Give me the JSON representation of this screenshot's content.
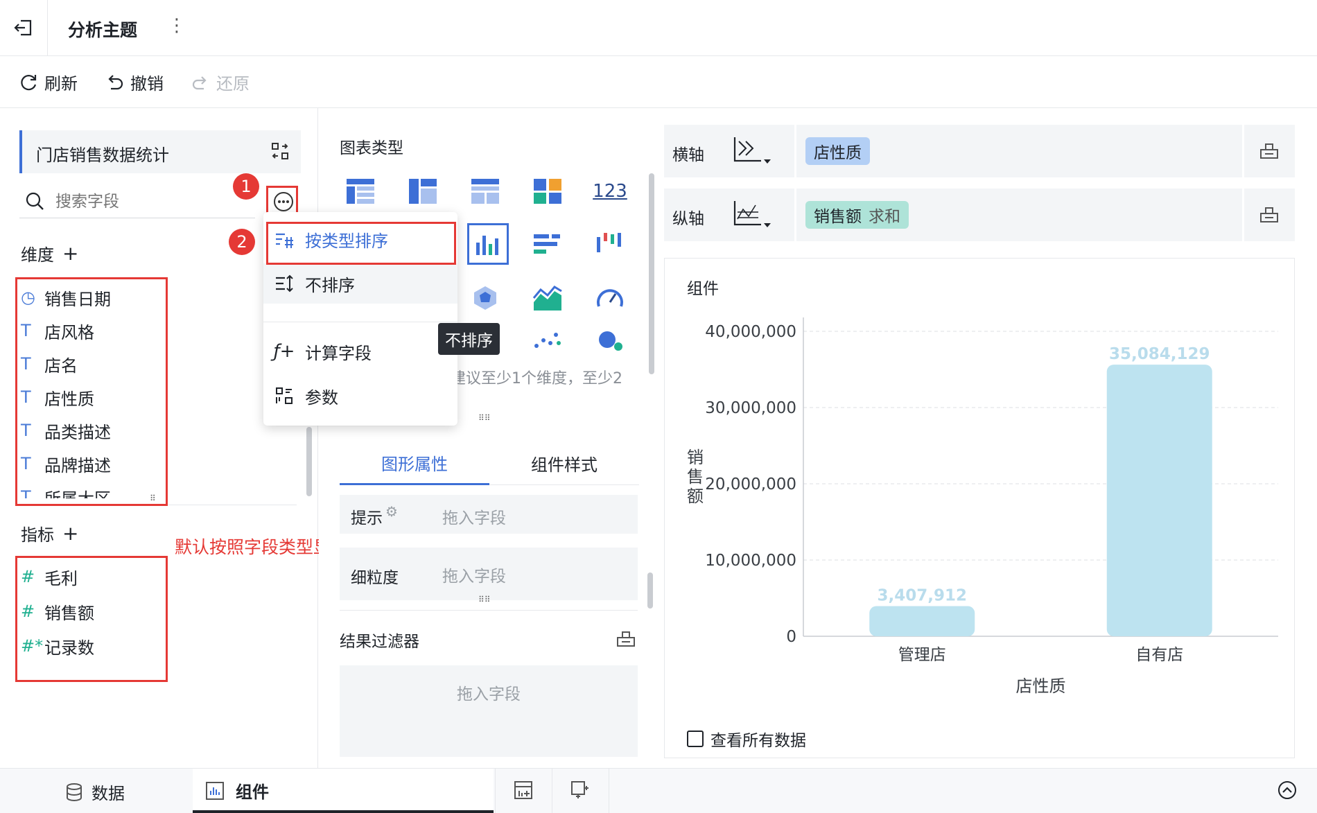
{
  "topbar": {
    "title": "分析主题",
    "more": "⋮"
  },
  "toolbar": {
    "refresh": "刷新",
    "undo": "撤销",
    "redo": "还原"
  },
  "left": {
    "dataset": "门店销售数据统计",
    "search_placeholder": "搜索字段",
    "dim_title": "维度",
    "dimensions": [
      "销售日期",
      "店风格",
      "店名",
      "店性质",
      "品类描述",
      "品牌描述",
      "所属大区"
    ],
    "measure_title": "指标",
    "measures": [
      "毛利",
      "销售额",
      "记录数"
    ],
    "annotation": "默认按照字段类型显示字段顺序"
  },
  "menu": {
    "items": [
      "按类型排序",
      "不排序",
      "计算字段",
      "参数"
    ],
    "badge1": "1",
    "badge2": "2",
    "tooltip": "不排序"
  },
  "mid": {
    "chart_type_title": "图表类型",
    "chart_123": "123",
    "hint": "建议至少1个维度，至少2",
    "tab_graph": "图形属性",
    "tab_style": "组件样式",
    "tip_label": "提示",
    "drag_here": "拖入字段",
    "granularity_label": "细粒度",
    "filter_title": "结果过滤器"
  },
  "right": {
    "x_axis_label": "横轴",
    "x_field": "店性质",
    "y_axis_label": "纵轴",
    "y_field": "销售额",
    "y_agg": "求和",
    "component_title": "组件",
    "view_all": "查看所有数据"
  },
  "chart_data": {
    "type": "bar",
    "categories": [
      "管理店",
      "自有店"
    ],
    "values": [
      3407912,
      35084129
    ],
    "value_labels": [
      "3,407,912",
      "35,084,129"
    ],
    "xlabel": "店性质",
    "ylabel": "销售额",
    "ylim": [
      0,
      40000000
    ],
    "ticks": [
      0,
      10000000,
      20000000,
      30000000,
      40000000
    ],
    "tick_labels": [
      "0",
      "10,000,000",
      "20,000,000",
      "30,000,000",
      "40,000,000"
    ],
    "bar_color": "#bde3f0",
    "label_color": "#b9dcec",
    "grid": true
  },
  "bottom": {
    "data_tab": "数据",
    "component_tab": "组件"
  },
  "colors": {
    "accent": "#3d6fd6",
    "highlight": "#e53935",
    "x_pill": "#b3cff5",
    "y_pill": "#aee3d8"
  }
}
